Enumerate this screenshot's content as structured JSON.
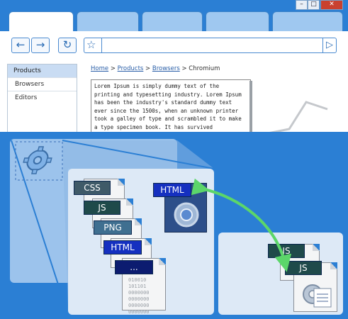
{
  "browser": {
    "back_icon": "arrow-left-icon",
    "forward_icon": "arrow-right-icon",
    "reload_icon": "reload-icon",
    "bookmark_icon": "star-icon",
    "go_icon": "play-icon",
    "window_controls": [
      "minimize",
      "maximize",
      "close"
    ]
  },
  "sidebar": {
    "items": [
      {
        "label": "Products"
      },
      {
        "label": "Browsers"
      },
      {
        "label": "Editors"
      }
    ]
  },
  "breadcrumb": {
    "items": [
      "Home",
      "Products",
      "Browsers",
      "Chromium"
    ],
    "separator": ">"
  },
  "body_text": "Lorem Ipsum is simply dummy text of the printing and typesetting industry. Lorem Ipsum has been the industry's standard dummy text ever since the 1500s, when an unknown printer took a galley of type and scrambled it to make a type specimen book. It has survived",
  "resources": {
    "stack": [
      "CSS",
      "JS",
      "PNG",
      "HTML",
      "..."
    ],
    "html_doc": "HTML",
    "right_stack": [
      "JS",
      "JS"
    ],
    "binary_lines": [
      "010010",
      "101101",
      "0000000",
      "0000000",
      "0000000",
      "0000000"
    ]
  },
  "colors": {
    "accent_blue": "#2b7fd4",
    "arrow_green": "#5cd66a",
    "css_label": "#3f5a68",
    "js_label": "#1f4a4a",
    "png_label": "#3f6f90",
    "html_label": "#1530c0",
    "dots_label": "#0c1c70"
  }
}
